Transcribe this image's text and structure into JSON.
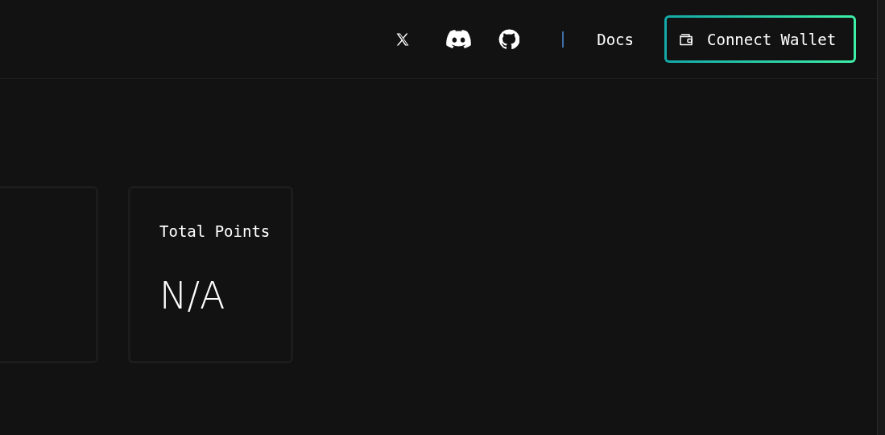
{
  "header": {
    "nav_link": "Docs",
    "connect_button": "Connect Wallet"
  },
  "stat_card": {
    "label": "Total Points",
    "value": "N/A"
  }
}
